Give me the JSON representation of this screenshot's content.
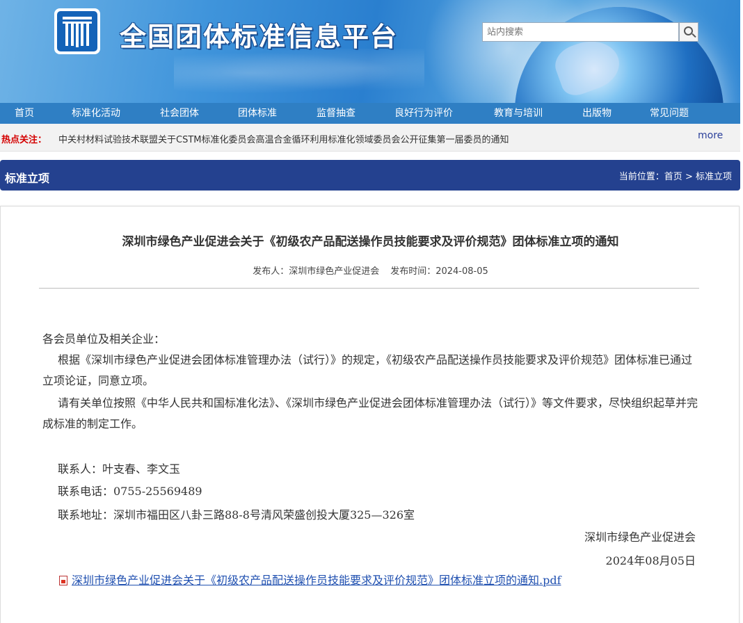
{
  "site": {
    "title": "全国团体标准信息平台",
    "search_placeholder": "站内搜索"
  },
  "nav": {
    "items": [
      "首页",
      "标准化活动",
      "社会团体",
      "团体标准",
      "监督抽查",
      "良好行为评价",
      "教育与培训",
      "出版物",
      "常见问题"
    ]
  },
  "hotbar": {
    "label": "热点关注：",
    "text": "中关村材料试验技术联盟关于CSTM标准化委员会高温合金循环利用标准化领域委员会公开征集第一届委员的通知",
    "more": "more"
  },
  "section": {
    "title": "标准立项",
    "breadcrumb_prefix": "当前位置：",
    "breadcrumb_home": "首页",
    "breadcrumb_sep": " > ",
    "breadcrumb_current": "标准立项"
  },
  "article": {
    "title": "深圳市绿色产业促进会关于《初级农产品配送操作员技能要求及评价规范》团体标准立项的通知",
    "publisher": "发布人：深圳市绿色产业促进会",
    "publish_time": "发布时间：2024-08-05",
    "salutation": "各会员单位及相关企业：",
    "paragraph1": "根据《深圳市绿色产业促进会团体标准管理办法（试行）》的规定，《初级农产品配送操作员技能要求及评价规范》团体标准已通过立项论证，同意立项。",
    "paragraph2": "请有关单位按照《中华人民共和国标准化法》、《深圳市绿色产业促进会团体标准管理办法（试行）》等文件要求，尽快组织起草并完成标准的制定工作。",
    "contact_person": "联系人：叶支春、李文玉",
    "contact_phone": "联系电话：0755-25569489",
    "contact_address": "联系地址：深圳市福田区八卦三路88-8号清风荣盛创投大厦325—326室",
    "signature_org": "深圳市绿色产业促进会",
    "signature_date": "2024年08月05日",
    "attachment": "深圳市绿色产业促进会关于《初级农产品配送操作员技能要求及评价规范》团体标准立项的通知.pdf"
  },
  "colors": {
    "nav_bg": "#2f7fc4",
    "section_bg": "#24418f",
    "hot_label": "#d40000",
    "link": "#2050b0"
  }
}
